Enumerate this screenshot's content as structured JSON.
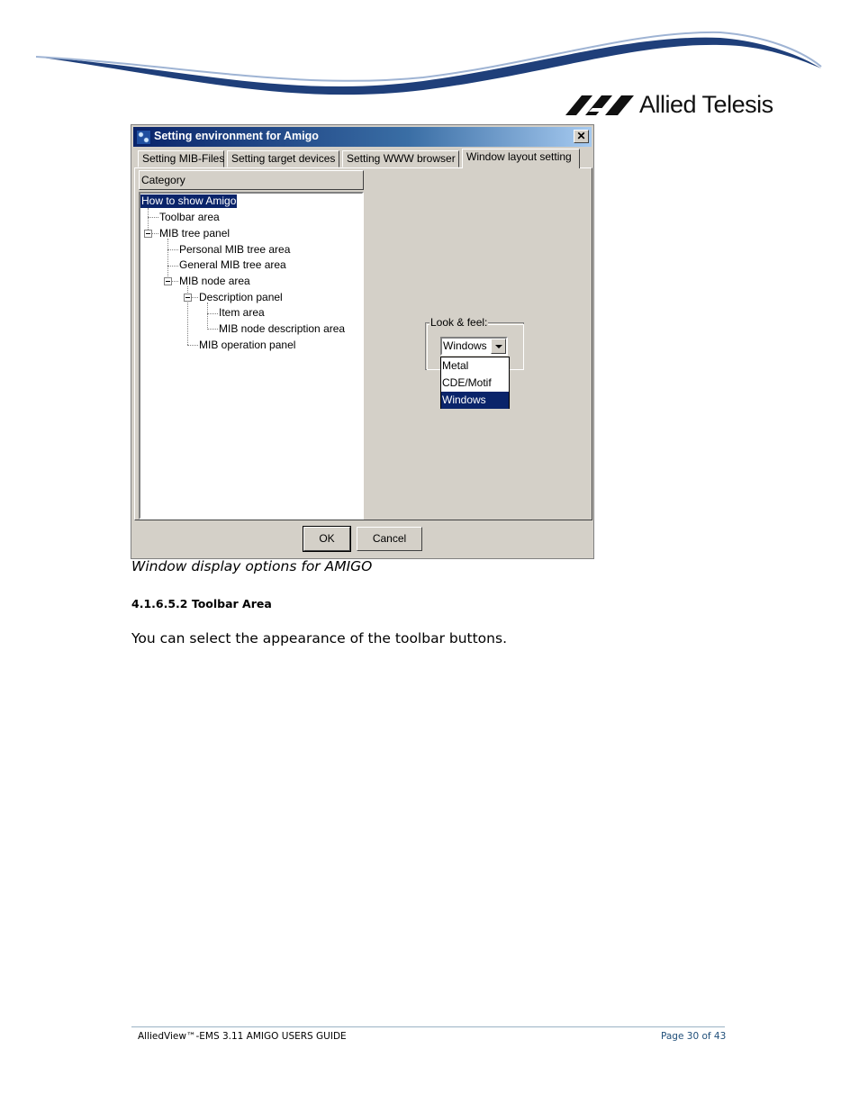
{
  "header": {
    "logo_text": "Allied Telesis",
    "colors": {
      "swoosh": "#1f3f7a",
      "swoosh_light": "#9fb4d4"
    }
  },
  "dialog": {
    "title": "Setting environment for Amigo",
    "close_label": "✕",
    "tabs": [
      {
        "label": "Setting MIB-Files"
      },
      {
        "label": "Setting target devices"
      },
      {
        "label": "Setting WWW browser"
      },
      {
        "label": "Window layout setting"
      }
    ],
    "category_label": "Category",
    "tree": [
      {
        "label": "How to show Amigo"
      },
      {
        "label": "Toolbar area"
      },
      {
        "label": "MIB tree panel"
      },
      {
        "label": "Personal MIB tree area"
      },
      {
        "label": "General MIB tree area"
      },
      {
        "label": "MIB node area"
      },
      {
        "label": "Description panel"
      },
      {
        "label": "Item area"
      },
      {
        "label": "MIB node description area"
      },
      {
        "label": "MIB operation panel"
      }
    ],
    "look_and_feel": {
      "label": "Look & feel:",
      "selected": "Windows",
      "options": [
        "Metal",
        "CDE/Motif",
        "Windows"
      ]
    },
    "ok_label": "OK",
    "cancel_label": "Cancel",
    "colors": {
      "titlebar": "#0a246a",
      "selection": "#0a246a",
      "face": "#d4d0c8"
    }
  },
  "document": {
    "caption": "Window display options for AMIGO",
    "section_heading": "4.1.6.5.2 Toolbar Area",
    "body": "You can select the appearance of the toolbar buttons."
  },
  "footer": {
    "left": "AlliedView™-EMS 3.11 AMIGO USERS GUIDE",
    "right": "Page 30 of 43"
  }
}
